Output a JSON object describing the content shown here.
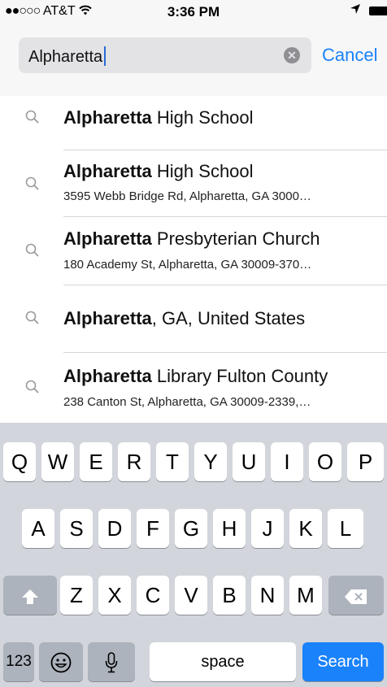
{
  "status_bar": {
    "signal_dots": "●●○○○",
    "carrier": "AT&T",
    "wifi_icon": "wifi-icon",
    "time": "3:36 PM",
    "location_icon": "location-arrow-icon",
    "battery_icon": "battery-icon"
  },
  "search": {
    "query": "Alpharetta",
    "clear_icon": "clear-icon",
    "cancel_label": "Cancel"
  },
  "results": [
    {
      "bold": "Alpharetta",
      "rest": " High School",
      "sub": ""
    },
    {
      "bold": "Alpharetta",
      "rest": " High School",
      "sub": "3595 Webb Bridge Rd, Alpharetta, GA  3000…"
    },
    {
      "bold": "Alpharetta",
      "rest": " Presbyterian Church",
      "sub": "180 Academy St, Alpharetta, GA  30009-370…"
    },
    {
      "bold": "Alpharetta",
      "rest": ", GA, United States",
      "sub": ""
    },
    {
      "bold": "Alpharetta",
      "rest": " Library Fulton County",
      "sub": "238 Canton St, Alpharetta, GA  30009-2339,…"
    }
  ],
  "keyboard": {
    "row1": [
      "Q",
      "W",
      "E",
      "R",
      "T",
      "Y",
      "U",
      "I",
      "O",
      "P"
    ],
    "row2": [
      "A",
      "S",
      "D",
      "F",
      "G",
      "H",
      "J",
      "K",
      "L"
    ],
    "row3": [
      "Z",
      "X",
      "C",
      "V",
      "B",
      "N",
      "M"
    ],
    "shift_icon": "shift-icon",
    "backspace_icon": "backspace-icon",
    "numbers_label": "123",
    "emoji_icon": "emoji-icon",
    "mic_icon": "microphone-icon",
    "space_label": "space",
    "search_label": "Search"
  },
  "colors": {
    "accent": "#1a82fb",
    "keyboard_bg": "#d2d5db",
    "search_field_bg": "#e3e3e5"
  }
}
